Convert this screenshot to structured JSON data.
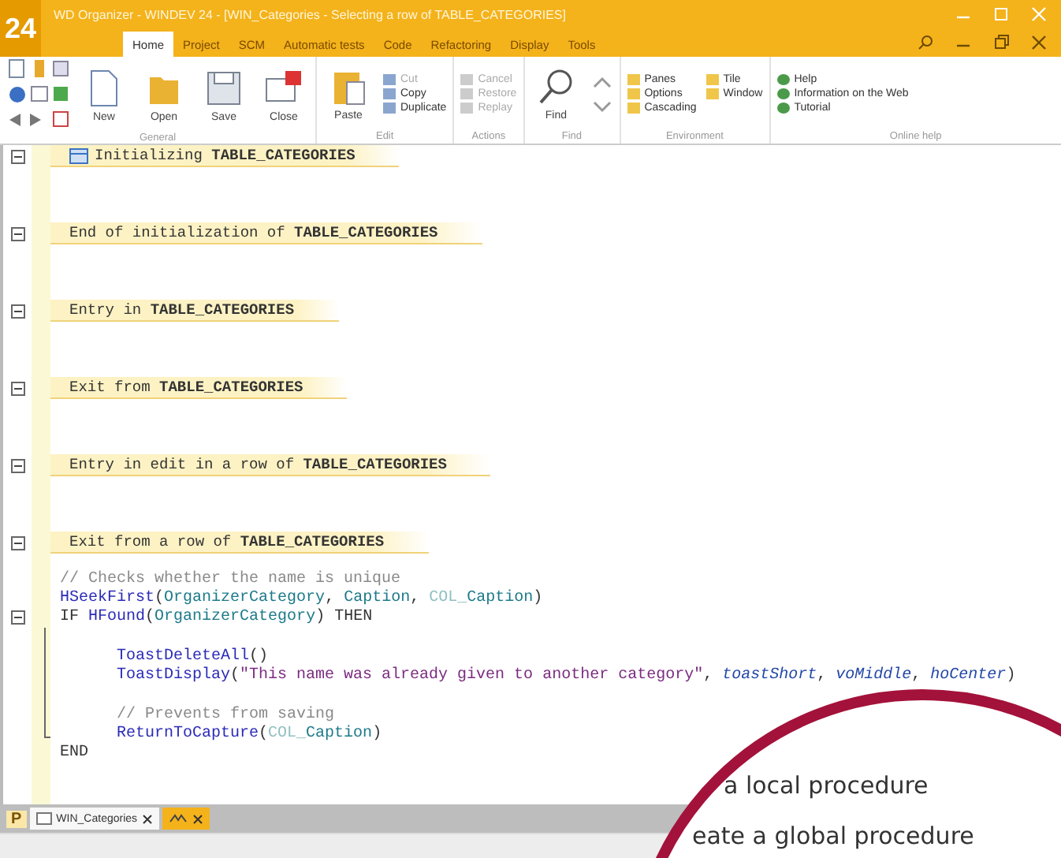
{
  "window": {
    "title": "WD Organizer - WINDEV 24 - [WIN_Categories - Selecting a row of TABLE_CATEGORIES]",
    "logo": "24"
  },
  "tabs": [
    {
      "label": "Home",
      "selected": true
    },
    {
      "label": "Project",
      "selected": false
    },
    {
      "label": "SCM",
      "selected": false
    },
    {
      "label": "Automatic tests",
      "selected": false
    },
    {
      "label": "Code",
      "selected": false
    },
    {
      "label": "Refactoring",
      "selected": false
    },
    {
      "label": "Display",
      "selected": false
    },
    {
      "label": "Tools",
      "selected": false
    }
  ],
  "ribbon": {
    "general": {
      "label": "General",
      "buttons": [
        "New",
        "Open",
        "Save",
        "Close"
      ]
    },
    "edit": {
      "label": "Edit",
      "paste": "Paste",
      "items": [
        "Cut",
        "Copy",
        "Duplicate"
      ]
    },
    "actions": {
      "label": "Actions",
      "items": [
        "Cancel",
        "Restore",
        "Replay"
      ]
    },
    "find": {
      "label": "Find",
      "button": "Find"
    },
    "environment": {
      "label": "Environment",
      "items": [
        "Panes",
        "Tile",
        "Options",
        "Window",
        "Cascading"
      ]
    },
    "help": {
      "label": "Online help",
      "items": [
        "Help",
        "Information on the Web",
        "Tutorial"
      ]
    }
  },
  "sections": [
    {
      "header": "Initializing **TABLE_CATEGORIES**",
      "icon": true
    },
    {
      "header": "End of initialization of **TABLE_CATEGORIES**",
      "icon": false
    },
    {
      "header": "Entry in **TABLE_CATEGORIES**",
      "icon": false
    },
    {
      "header": "Exit from **TABLE_CATEGORIES**",
      "icon": false
    },
    {
      "header": "Entry in edit in a row of **TABLE_CATEGORIES**",
      "icon": false
    },
    {
      "header": "Exit from a row of **TABLE_CATEGORIES**",
      "icon": false
    }
  ],
  "code_lines": [
    {
      "kind": "code",
      "tokens": [
        {
          "text": "// Checks whether the name is unique",
          "kind": "comment"
        }
      ]
    },
    {
      "kind": "code",
      "tokens": [
        {
          "text": "HSeekFirst",
          "kind": "func"
        },
        {
          "text": "(",
          "kind": "plain"
        },
        {
          "text": "OrganizerCategory",
          "kind": "ident"
        },
        {
          "text": ", ",
          "kind": "plain"
        },
        {
          "text": "Caption",
          "kind": "ident"
        },
        {
          "text": ", ",
          "kind": "plain"
        },
        {
          "text": "COL_",
          "kind": "dim"
        },
        {
          "text": "Caption",
          "kind": "ident"
        },
        {
          "text": ")",
          "kind": "plain"
        }
      ]
    },
    {
      "kind": "code",
      "tokens": [
        {
          "text": "IF ",
          "kind": "keyword"
        },
        {
          "text": "HFound",
          "kind": "func"
        },
        {
          "text": "(",
          "kind": "plain"
        },
        {
          "text": "OrganizerCategory",
          "kind": "ident"
        },
        {
          "text": ") THEN",
          "kind": "keyword"
        }
      ],
      "children": [
        {
          "kind": "blank"
        },
        {
          "kind": "code",
          "tokens": [
            {
              "text": "ToastDeleteAll",
              "kind": "func"
            },
            {
              "text": "()",
              "kind": "plain"
            }
          ]
        },
        {
          "kind": "code",
          "tokens": [
            {
              "text": "ToastDisplay",
              "kind": "func"
            },
            {
              "text": "(",
              "kind": "plain"
            },
            {
              "text": "\"This name was already given to another category\"",
              "kind": "string"
            },
            {
              "text": ", ",
              "kind": "plain"
            },
            {
              "text": "toastShort",
              "kind": "const"
            },
            {
              "text": ", ",
              "kind": "plain"
            },
            {
              "text": "voMiddle",
              "kind": "const"
            },
            {
              "text": ", ",
              "kind": "plain"
            },
            {
              "text": "hoCenter",
              "kind": "const"
            },
            {
              "text": ")",
              "kind": "plain"
            }
          ]
        },
        {
          "kind": "blank"
        },
        {
          "kind": "code",
          "tokens": [
            {
              "text": "// Prevents from saving",
              "kind": "comment"
            }
          ]
        },
        {
          "kind": "code",
          "tokens": [
            {
              "text": "ReturnToCapture",
              "kind": "func"
            },
            {
              "text": "(",
              "kind": "plain"
            },
            {
              "text": "COL_",
              "kind": "dim"
            },
            {
              "text": "Caption",
              "kind": "ident"
            },
            {
              "text": ")",
              "kind": "plain"
            }
          ]
        }
      ]
    },
    {
      "kind": "code",
      "tokens": [
        {
          "text": "END",
          "kind": "keyword"
        }
      ]
    }
  ],
  "editor_bar": {
    "project_label": "P"
  },
  "editor_tabs": [
    {
      "label": "WIN_Categories",
      "kind": "window",
      "selected": false
    },
    {
      "kind": "code",
      "selected": true
    }
  ],
  "magnifier": {
    "lines": [
      "a local procedure",
      "eate a global procedure"
    ]
  }
}
